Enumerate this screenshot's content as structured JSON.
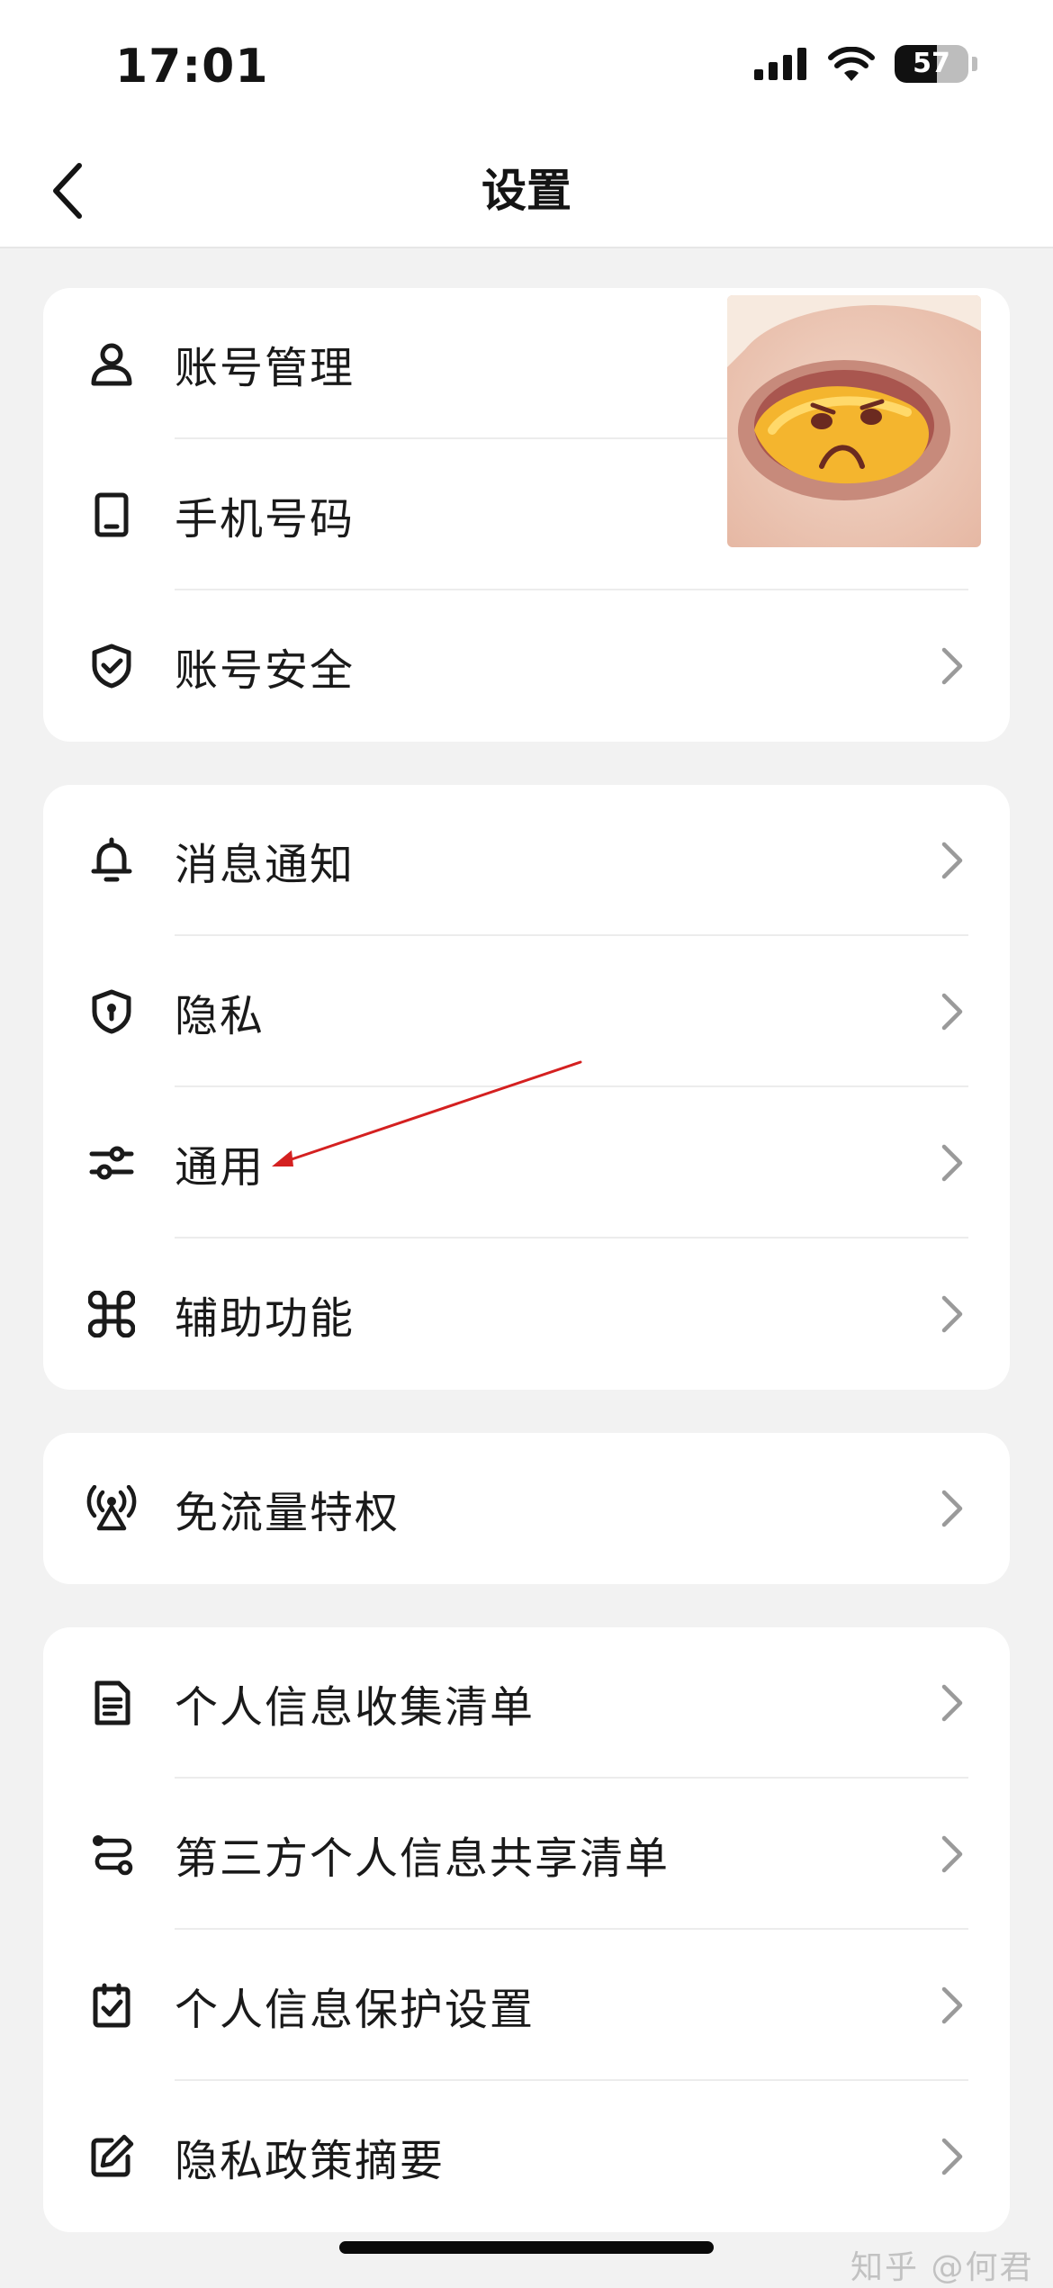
{
  "status_bar": {
    "time": "17:01",
    "battery_level": "57",
    "icons": [
      "cellular-signal-icon",
      "wifi-icon",
      "battery-icon"
    ]
  },
  "nav": {
    "title": "设置",
    "back_icon": "chevron-left-icon"
  },
  "sections": [
    {
      "items": [
        {
          "label": "账号管理",
          "icon": "person-icon"
        },
        {
          "label": "手机号码",
          "icon": "phone-icon"
        },
        {
          "label": "账号安全",
          "icon": "shield-check-icon"
        }
      ]
    },
    {
      "items": [
        {
          "label": "消息通知",
          "icon": "bell-icon"
        },
        {
          "label": "隐私",
          "icon": "shield-lock-icon"
        },
        {
          "label": "通用",
          "icon": "sliders-icon"
        },
        {
          "label": "辅助功能",
          "icon": "command-icon"
        }
      ]
    },
    {
      "items": [
        {
          "label": "免流量特权",
          "icon": "broadcast-icon"
        }
      ]
    },
    {
      "items": [
        {
          "label": "个人信息收集清单",
          "icon": "document-icon"
        },
        {
          "label": "第三方个人信息共享清单",
          "icon": "share-route-icon"
        },
        {
          "label": "个人信息保护设置",
          "icon": "checkbox-doc-icon"
        },
        {
          "label": "隐私政策摘要",
          "icon": "edit-icon"
        }
      ]
    }
  ],
  "watermark": "知乎 @何君",
  "colors": {
    "background": "#f2f2f2",
    "card": "#ffffff",
    "annotation_arrow": "#d42020",
    "chevron": "#9a9a9a"
  }
}
